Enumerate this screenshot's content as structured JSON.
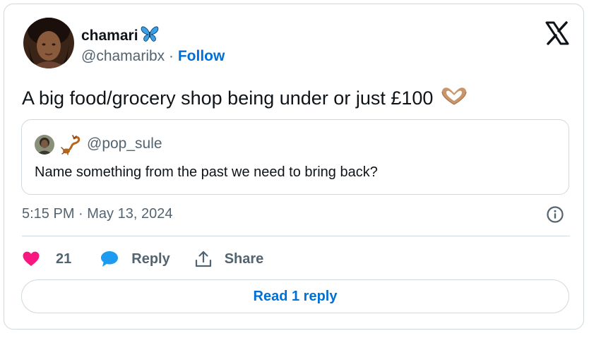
{
  "author": {
    "name": "chamari",
    "name_emoji_icon": "butterfly-icon",
    "handle": "@chamaribx",
    "separator": " · ",
    "follow_label": "Follow"
  },
  "tweet": {
    "text": "A big food/grocery shop being under or just £100",
    "emoji_icon": "heart-hands-icon"
  },
  "quote": {
    "handle": "@pop_sule",
    "emoji_icon": "scorpion-icon",
    "text": "Name something from the past we need to bring back?"
  },
  "meta": {
    "timestamp": "5:15 PM · May 13, 2024"
  },
  "actions": {
    "like_count": "21",
    "reply_label": "Reply",
    "share_label": "Share"
  },
  "read_replies_label": "Read 1 reply",
  "colors": {
    "link_blue": "#006fd6",
    "like_pink": "#f91880",
    "reply_blue": "#1d9bf0",
    "muted_text": "#536471",
    "border": "#cfd9de"
  }
}
